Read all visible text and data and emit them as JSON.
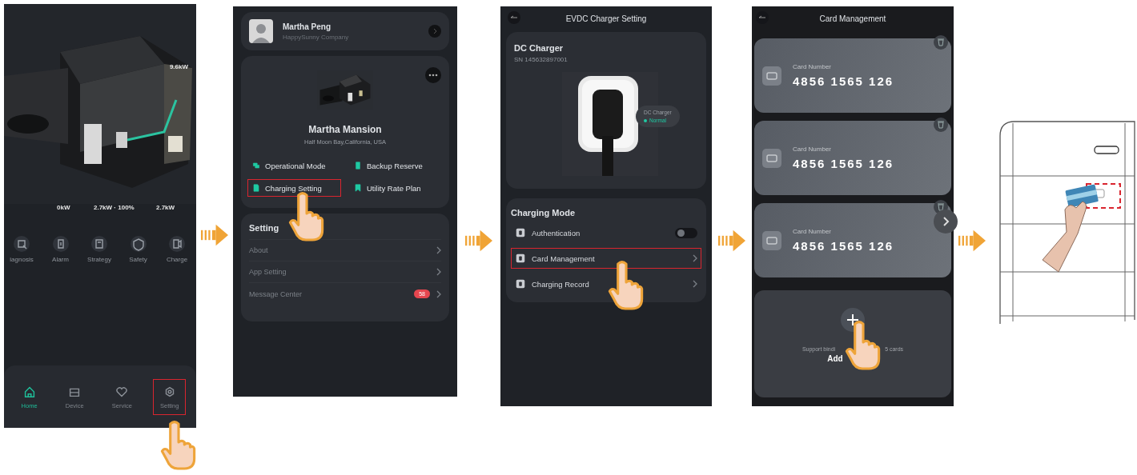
{
  "home_screen": {
    "readings": [
      {
        "value": "9.6kW"
      },
      {
        "value": "0kW"
      },
      {
        "value": "2.7kW · 100%"
      },
      {
        "value": "2.7kW"
      }
    ],
    "shortcuts": [
      {
        "label": "iagnosis"
      },
      {
        "label": "Alarm"
      },
      {
        "label": "Strategy"
      },
      {
        "label": "Safety"
      },
      {
        "label": "Charge"
      }
    ],
    "nav": [
      {
        "label": "Home",
        "selected": true,
        "highlighted": false
      },
      {
        "label": "Device",
        "selected": false,
        "highlighted": false
      },
      {
        "label": "Service",
        "selected": false,
        "highlighted": false
      },
      {
        "label": "Setting",
        "selected": false,
        "highlighted": true
      }
    ]
  },
  "settings_screen": {
    "user": {
      "name": "Martha Peng",
      "company": "HappySunny Company"
    },
    "home": {
      "name": "Martha Mansion",
      "address": "Half Moon Bay,California, USA"
    },
    "actions": [
      {
        "label": "Operational Mode",
        "highlighted": false
      },
      {
        "label": "Backup Reserve",
        "highlighted": false
      },
      {
        "label": "Charging Setting",
        "highlighted": true
      },
      {
        "label": "Utility Rate Plan",
        "highlighted": false
      }
    ],
    "section_title": "Setting",
    "menu": [
      {
        "label": "About"
      },
      {
        "label": "App Setting"
      },
      {
        "label": "Message Center",
        "badge": "58"
      }
    ]
  },
  "charger_screen": {
    "title": "EVDC Charger Setting",
    "device": {
      "name": "DC Charger",
      "serial": "SN 145632897001",
      "tooltip_title": "DC Charger",
      "status": "Normal"
    },
    "section_title": "Charging Mode",
    "items": [
      {
        "kind": "toggle",
        "label": "Authentication",
        "on": false,
        "highlighted": false
      },
      {
        "kind": "link",
        "label": "Card Management",
        "highlighted": true
      },
      {
        "kind": "link",
        "label": "Charging Record",
        "highlighted": false
      }
    ]
  },
  "cards_screen": {
    "title": "Card Management",
    "cards": [
      {
        "label": "Card Number",
        "number": "4856 1565 126"
      },
      {
        "label": "Card Number",
        "number": "4856 1565 126"
      },
      {
        "label": "Card Number",
        "number": "4856 1565 126"
      }
    ],
    "add": {
      "hint_start": "Support bindi",
      "hint_end": "5 cards",
      "label": "Add",
      "tapped": true
    }
  }
}
